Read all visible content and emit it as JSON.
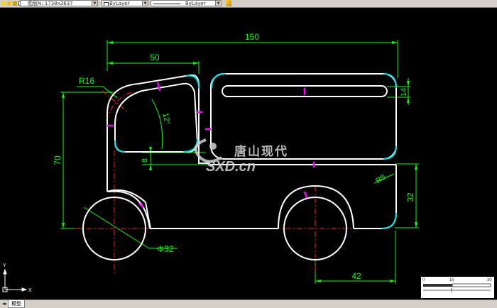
{
  "toolbar": {
    "layer_combo_value": "图层N: 1738x3637",
    "color_combo_value": "ByLayer",
    "linetype_combo_value": "ByLayer",
    "dropdown_arrow": "▼"
  },
  "drawing": {
    "dim_overall_width": "150",
    "dim_cab_width": "50",
    "dim_corner_radius": "R16",
    "dim_cab_angle": "12°",
    "dim_slot_height": "14",
    "dim_body_height": "70",
    "dim_gap": "8",
    "dim_rear_radius": "R8",
    "dim_rear_height": "32",
    "dim_wheel_diameter": "Φ32",
    "dim_rear_wheel_offset": "42"
  },
  "watermark": {
    "brand_cn": "唐山现代",
    "brand_en": "SXD.cn"
  },
  "ucs": {
    "y_label": "Y",
    "x_label": "X"
  },
  "scalebar": {
    "labels": [
      "0",
      "15",
      "30"
    ]
  },
  "statusbar": {
    "nav_arrows": "◂▸",
    "model_tab": "模型"
  },
  "colors": {
    "geometry": "#ffffff",
    "dimension": "#00ff00",
    "centerline": "#ff2020",
    "highlight": "#00e5e5",
    "grip": "#ff00ff",
    "background": "#000000"
  }
}
